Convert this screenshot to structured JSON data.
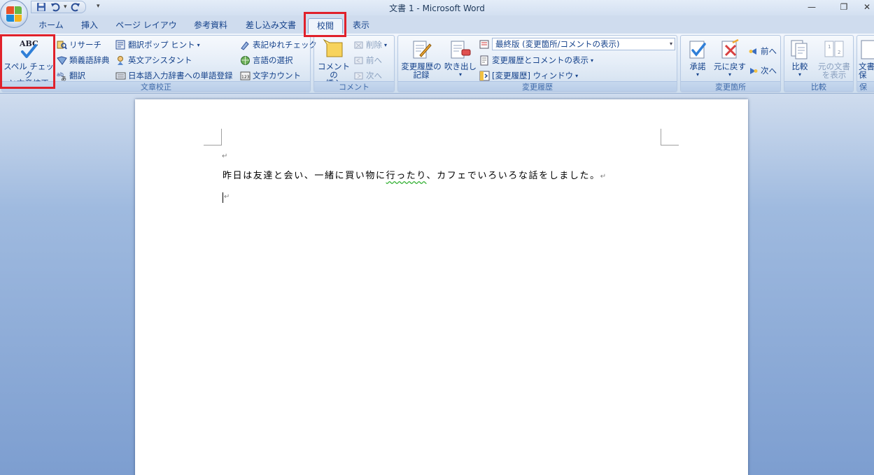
{
  "window": {
    "title": "文書 1 - Microsoft Word",
    "minimize": "—",
    "restore": "❐",
    "close": "✕"
  },
  "qat": {
    "save_icon": "save-icon",
    "undo_icon": "undo-icon",
    "redo_icon": "redo-icon",
    "dropdown": "▾",
    "customize": "▾"
  },
  "tabs": [
    {
      "label": "ホーム"
    },
    {
      "label": "挿入"
    },
    {
      "label": "ページ レイアウト"
    },
    {
      "label": "参考資料"
    },
    {
      "label": "差し込み文書"
    },
    {
      "label": "校閲",
      "active": true
    },
    {
      "label": "表示"
    }
  ],
  "ribbon": {
    "proofing": {
      "label": "文章校正",
      "spell_line1": "スペル チェック",
      "spell_line2": "と文章校正",
      "research": "リサーチ",
      "thesaurus": "類義語辞典",
      "translate": "翻訳",
      "translate_popup": "翻訳ポップ ヒント",
      "english_assistant": "英文アシスタント",
      "ime_register": "日本語入力辞書への単語登録",
      "variant_check": "表記ゆれチェック",
      "language": "言語の選択",
      "word_count": "文字カウント"
    },
    "comments": {
      "label": "コメント",
      "insert_line1": "コメントの",
      "insert_line2": "挿入",
      "delete": "削除",
      "previous": "前へ",
      "next": "次へ"
    },
    "tracking": {
      "label": "変更履歴",
      "track_line1": "変更履歴の",
      "track_line2": "記録",
      "balloons": "吹き出し",
      "display_mode": "最終版 (変更箇所/コメントの表示)",
      "show_markup": "変更履歴とコメントの表示",
      "reviewing_pane": "[変更履歴] ウィンドウ"
    },
    "changes": {
      "label": "変更箇所",
      "accept": "承諾",
      "reject": "元に戻す",
      "previous": "前へ",
      "next": "次へ"
    },
    "compare": {
      "label": "比較",
      "compare": "比較",
      "show_source_line1": "元の文書",
      "show_source_line2": "を表示"
    },
    "protect": {
      "label": "保",
      "protect_line1": "文書",
      "protect_line2": "保"
    }
  },
  "document": {
    "paragraph_mark": "↵",
    "line1": "昨日は友達と会い、一緒に買い物に",
    "misspelled": "行ったり",
    "line1_rest": "、カフェでいろいろな話をしました。"
  }
}
